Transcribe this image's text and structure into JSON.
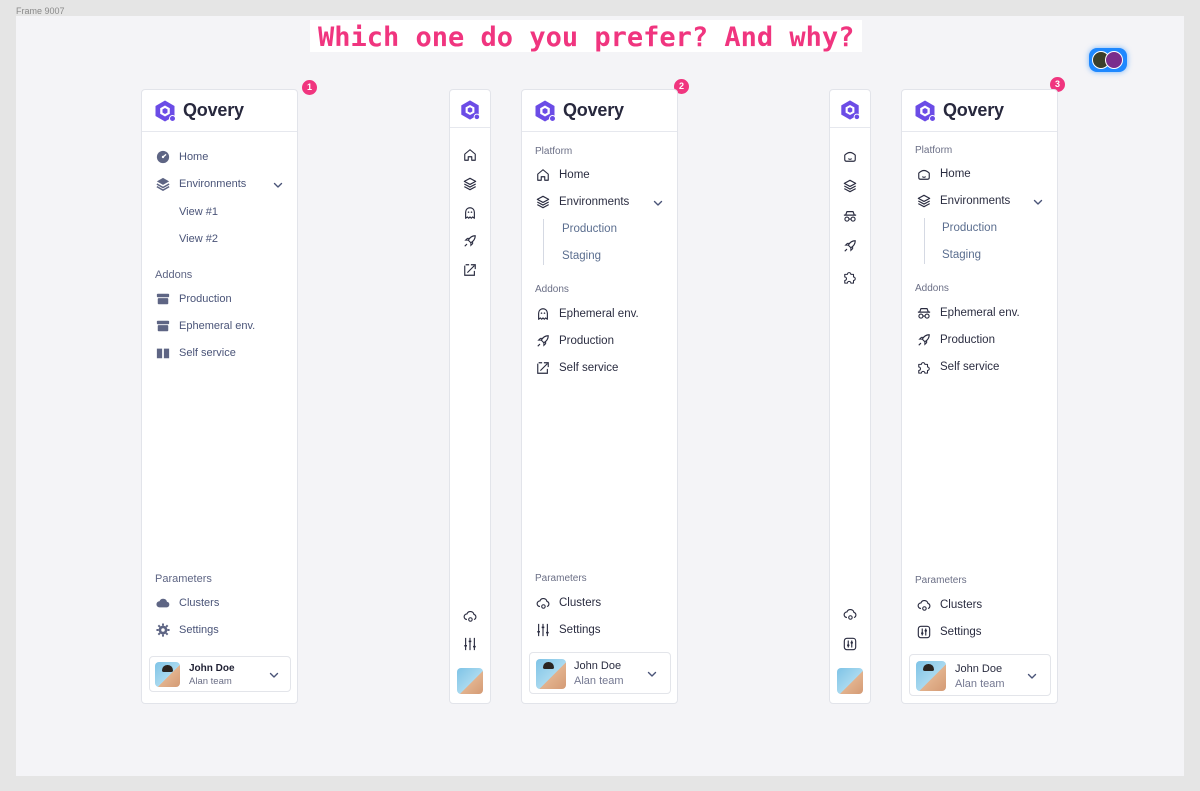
{
  "frame_label": "Frame 9007",
  "headline": "Which one do you prefer? And why?",
  "badges": [
    "1",
    "2",
    "3"
  ],
  "brand": {
    "name": "Qovery",
    "accent": "#6b4ce6",
    "highlight": "#f0357f"
  },
  "option1": {
    "nav": [
      {
        "label": "Home",
        "icon": "dashboard-icon"
      },
      {
        "label": "Environments",
        "icon": "layers-icon"
      }
    ],
    "sub_items": [
      "View #1",
      "View #2"
    ],
    "addons_title": "Addons",
    "addons": [
      {
        "label": "Production",
        "icon": "box-icon"
      },
      {
        "label": "Ephemeral env.",
        "icon": "box-icon"
      },
      {
        "label": "Self service",
        "icon": "book-icon"
      }
    ],
    "parameters_title": "Parameters",
    "parameters": [
      {
        "label": "Clusters",
        "icon": "cloud-icon"
      },
      {
        "label": "Settings",
        "icon": "gear-icon"
      }
    ],
    "user": {
      "name": "John Doe",
      "team": "Alan team"
    }
  },
  "option2": {
    "platform_title": "Platform",
    "nav": [
      {
        "label": "Home",
        "icon": "home-icon"
      },
      {
        "label": "Environments",
        "icon": "layers-icon"
      }
    ],
    "sub_items": [
      "Production",
      "Staging"
    ],
    "addons_title": "Addons",
    "addons": [
      {
        "label": "Ephemeral env.",
        "icon": "ghost-icon"
      },
      {
        "label": "Production",
        "icon": "rocket-icon"
      },
      {
        "label": "Self service",
        "icon": "slash-box-icon"
      }
    ],
    "parameters_title": "Parameters",
    "parameters": [
      {
        "label": "Clusters",
        "icon": "cloud-gear-icon"
      },
      {
        "label": "Settings",
        "icon": "sliders-icon"
      }
    ],
    "user": {
      "name": "John Doe",
      "team": "Alan team"
    }
  },
  "option3": {
    "platform_title": "Platform",
    "nav": [
      {
        "label": "Home",
        "icon": "home-soft-icon"
      },
      {
        "label": "Environments",
        "icon": "layers-icon"
      }
    ],
    "sub_items": [
      "Production",
      "Staging"
    ],
    "addons_title": "Addons",
    "addons": [
      {
        "label": "Ephemeral env.",
        "icon": "incognito-icon"
      },
      {
        "label": "Production",
        "icon": "rocket-icon"
      },
      {
        "label": "Self service",
        "icon": "puzzle-icon"
      }
    ],
    "parameters_title": "Parameters",
    "parameters": [
      {
        "label": "Clusters",
        "icon": "cloud-gear-icon"
      },
      {
        "label": "Settings",
        "icon": "toggles-icon"
      }
    ],
    "user": {
      "name": "John Doe",
      "team": "Alan team"
    }
  }
}
